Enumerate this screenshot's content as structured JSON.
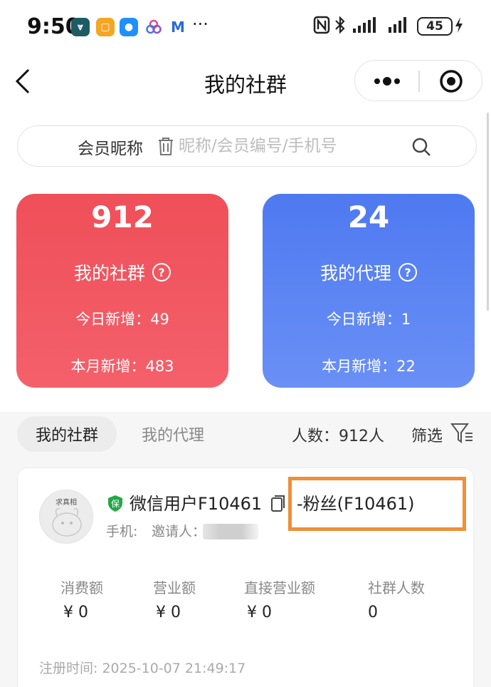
{
  "status_bar": {
    "time": "9:50",
    "more": "···",
    "battery": "45",
    "icons": [
      "nfc-icon",
      "bluetooth-icon",
      "signal-icon",
      "signal-icon",
      "charging-icon"
    ]
  },
  "header": {
    "title": "我的社群",
    "back_icon": "chevron-left-icon",
    "menu_icon": "more-icon",
    "close_icon": "target-icon"
  },
  "search": {
    "type_label": "会员昵称",
    "placeholder": "昵称/会员编号/手机号",
    "value": ""
  },
  "stats": {
    "community": {
      "count": "912",
      "label": "我的社群",
      "today": "今日新增：49",
      "month": "本月新增：483",
      "color": "#ef4f59"
    },
    "agent": {
      "count": "24",
      "label": "我的代理",
      "today": "今日新增：1",
      "month": "本月新增：22",
      "color": "#4e79f0"
    },
    "help": "?"
  },
  "tabs": {
    "active": "我的社群",
    "inactive": "我的代理",
    "count": "人数：912人",
    "filter": "筛选"
  },
  "member": {
    "avatar_text": "求真相",
    "name": "微信用户F10461",
    "fans": "-粉丝(F10461)",
    "phone_label": "手机:",
    "inviter_label": "邀请人：",
    "metrics": [
      {
        "label": "消费额",
        "value": "¥ 0"
      },
      {
        "label": "营业额",
        "value": "¥ 0"
      },
      {
        "label": "直接营业额",
        "value": "¥ 0"
      },
      {
        "label": "社群人数",
        "value": "0"
      }
    ],
    "reg_time": "注册时间: 2025-10-07 21:49:17",
    "highlight_color": "#ee8f3a"
  }
}
